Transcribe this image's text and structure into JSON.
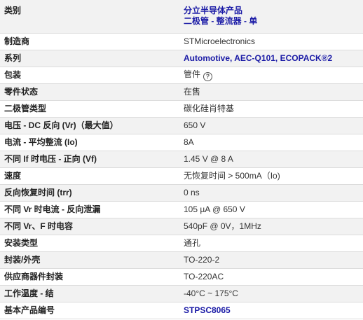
{
  "rows": [
    {
      "label": "类别",
      "values": [
        "分立半导体产品",
        "二极管 - 整流器 - 单"
      ]
    },
    {
      "label": "制造商",
      "value": "STMicroelectronics"
    },
    {
      "label": "系列",
      "value": "Automotive, AEC-Q101, ECOPACK®2"
    },
    {
      "label": "包装",
      "value": "管件"
    },
    {
      "label": "零件状态",
      "value": "在售"
    },
    {
      "label": "二极管类型",
      "value": "碳化硅肖特基"
    },
    {
      "label": "电压 - DC 反向 (Vr)（最大值）",
      "value": "650 V"
    },
    {
      "label": "电流 - 平均整流 (Io)",
      "value": "8A"
    },
    {
      "label": "不同 If 时电压 - 正向 (Vf)",
      "value": "1.45 V @ 8 A"
    },
    {
      "label": "速度",
      "value": "无恢复时间 > 500mA（Io)"
    },
    {
      "label": "反向恢复时间 (trr)",
      "value": "0 ns"
    },
    {
      "label": "不同 Vr 时电流 - 反向泄漏",
      "value": "105 µA @ 650 V"
    },
    {
      "label": "不同 Vr、F 时电容",
      "value": "540pF @ 0V，1MHz"
    },
    {
      "label": "安装类型",
      "value": "通孔"
    },
    {
      "label": "封装/外壳",
      "value": "TO-220-2"
    },
    {
      "label": "供应商器件封装",
      "value": "TO-220AC"
    },
    {
      "label": "工作温度 - 结",
      "value": "-40°C ~ 175°C"
    },
    {
      "label": "基本产品编号",
      "value": "STPSC8065"
    }
  ],
  "help_icon": {
    "name": "question-circle-icon",
    "glyph": "?"
  },
  "colors": {
    "link": "#1a1aa6",
    "stripe": "#f2f2f2",
    "border": "#dcdcdc"
  }
}
